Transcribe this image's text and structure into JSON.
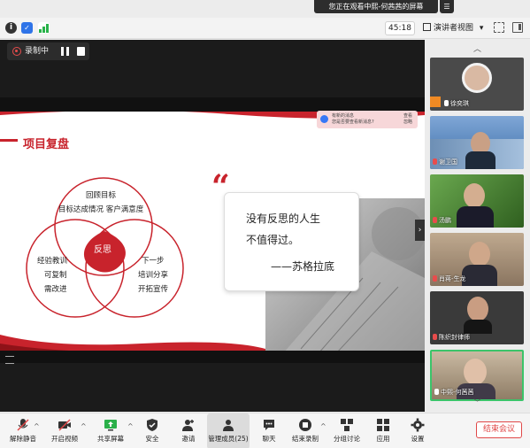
{
  "banner": {
    "text": "您正在观看中熙-何茜茜的屏幕",
    "menu_icon": "menu-icon"
  },
  "titlebar": {
    "timer": "45:18",
    "view_label": "演讲者视图",
    "view_caret": "▾"
  },
  "recording": {
    "label": "录制中"
  },
  "slide": {
    "title": "项目复盘",
    "venn": {
      "top_title": "回顾目标",
      "top_sub": "目标达成情况  客户满意度",
      "left_1": "经验教训",
      "left_2": "可复制",
      "left_3": "需改进",
      "right_1": "下一步",
      "right_2": "培训分享",
      "right_3": "开拓宣传",
      "center": "反思"
    },
    "quote": {
      "mark": "“",
      "line1": "没有反思的人生",
      "line2": "不值得过。",
      "author": "——苏格拉底"
    },
    "notice": {
      "t1": "有新的消息",
      "t2": "您是否要查看新消息?",
      "b1": "查看",
      "b2": "忽略"
    }
  },
  "participants": [
    {
      "name": "徐奕琪"
    },
    {
      "name": "谢卫国"
    },
    {
      "name": "汤鹏"
    },
    {
      "name": "肖蒋-生龙"
    },
    {
      "name": "陈织封律师"
    },
    {
      "name": "中熙-何茜茜"
    }
  ],
  "toolbar": {
    "items": [
      {
        "label": "解除静音"
      },
      {
        "label": "开启视频"
      },
      {
        "label": "共享屏幕"
      },
      {
        "label": "安全"
      },
      {
        "label": "邀请"
      },
      {
        "label": "管理成员(25)"
      },
      {
        "label": "聊天"
      },
      {
        "label": "结束录制"
      },
      {
        "label": "分组讨论"
      },
      {
        "label": "应用"
      },
      {
        "label": "设置"
      }
    ],
    "end_label": "结束会议"
  },
  "colors": {
    "accent_red": "#c8232c",
    "end_red": "#e04848",
    "stage_bg": "#1b1b1b"
  }
}
